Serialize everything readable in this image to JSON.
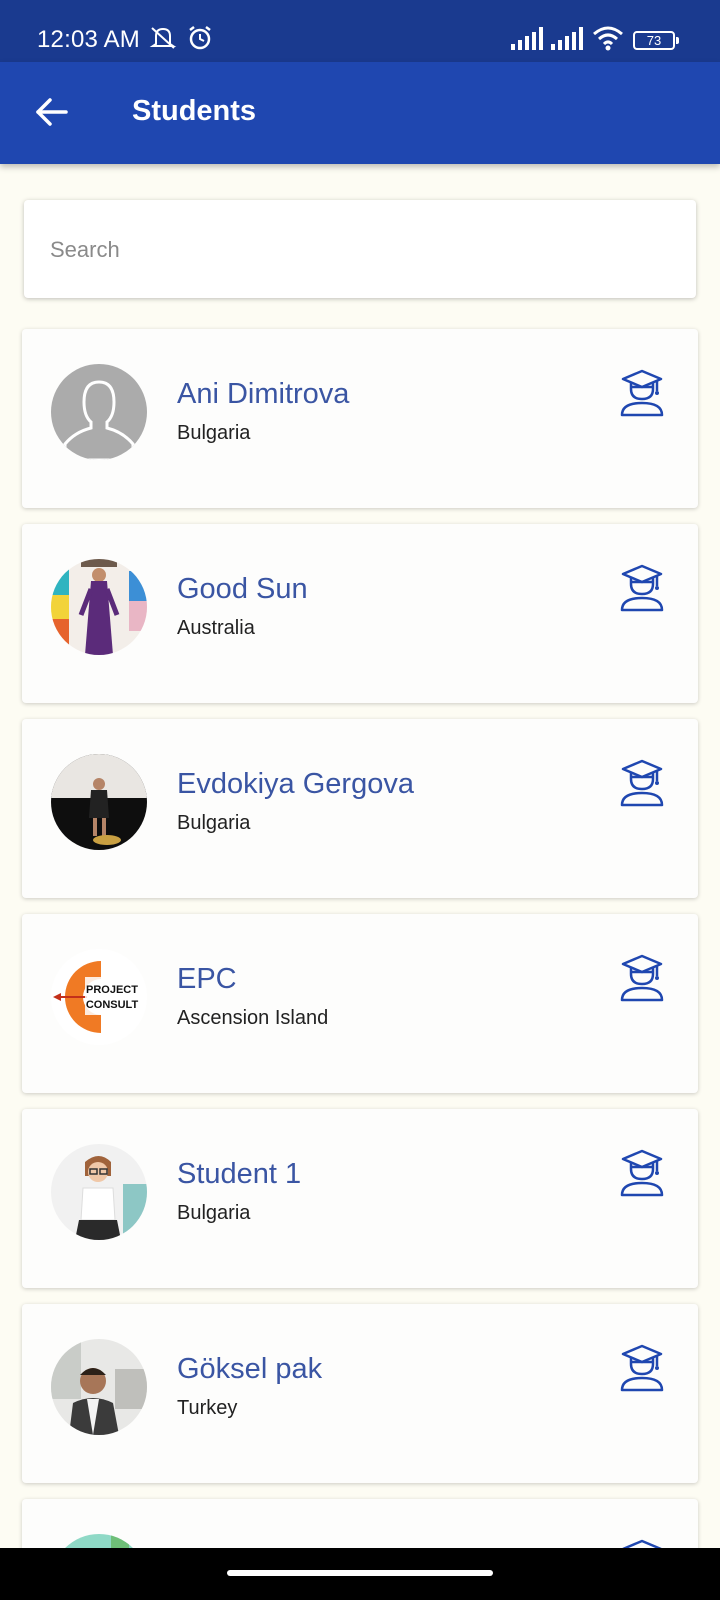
{
  "status_bar": {
    "time": "12:03 AM",
    "battery": "73",
    "icons": [
      "muted-notifications-icon",
      "alarm-icon",
      "signal-icon",
      "signal-icon",
      "wifi-icon",
      "battery-icon"
    ]
  },
  "app_bar": {
    "title": "Students",
    "back_icon": "arrow-back-icon"
  },
  "search": {
    "placeholder": "Search",
    "value": ""
  },
  "students": [
    {
      "name": "Ani Dimitrova",
      "country": "Bulgaria"
    },
    {
      "name": "Good Sun",
      "country": "Australia"
    },
    {
      "name": "Evdokiya Gergova",
      "country": "Bulgaria"
    },
    {
      "name": "EPC",
      "country": "Ascension Island",
      "avatar_text": "PROJECT CONSULT"
    },
    {
      "name": "Student 1",
      "country": "Bulgaria"
    },
    {
      "name": "Göksel pak",
      "country": "Turkey"
    }
  ],
  "colors": {
    "status_bar": "#1a3a8f",
    "app_bar": "#1f47b0",
    "accent_text": "#3a55a3",
    "background": "#fdfcf3"
  }
}
